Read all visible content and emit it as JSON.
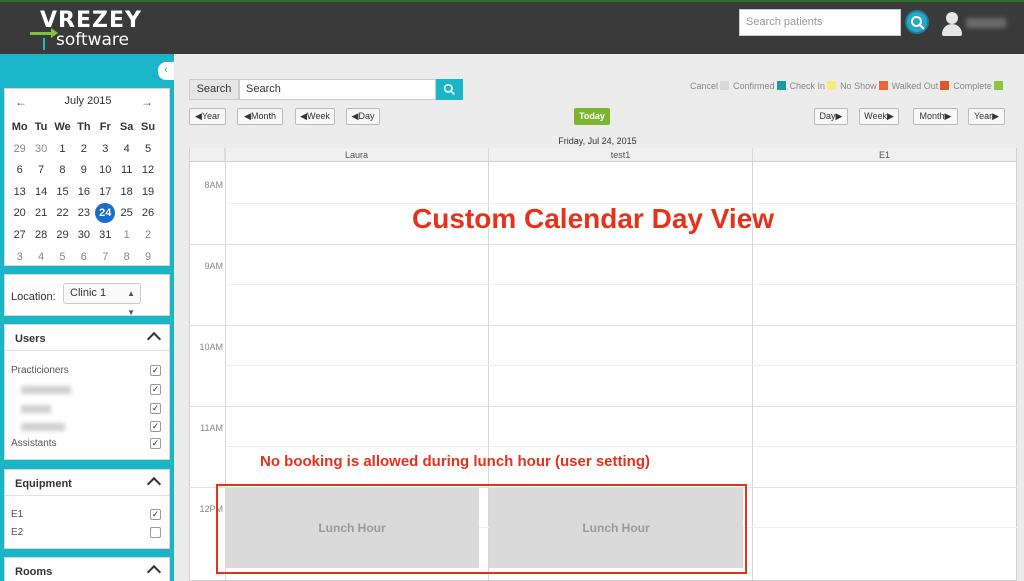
{
  "header": {
    "brand": "VREZEY",
    "brand_sub": "software",
    "search_placeholder": "Search patients"
  },
  "mini_calendar": {
    "month_label": "July 2015",
    "days_of_week": [
      "Mo",
      "Tu",
      "We",
      "Th",
      "Fr",
      "Sa",
      "Su"
    ],
    "weeks": [
      [
        "29",
        "30",
        "1",
        "2",
        "3",
        "4",
        "5"
      ],
      [
        "6",
        "7",
        "8",
        "9",
        "10",
        "11",
        "12"
      ],
      [
        "13",
        "14",
        "15",
        "16",
        "17",
        "18",
        "19"
      ],
      [
        "20",
        "21",
        "22",
        "23",
        "24",
        "25",
        "26"
      ],
      [
        "27",
        "28",
        "29",
        "30",
        "31",
        "1",
        "2"
      ],
      [
        "3",
        "4",
        "5",
        "6",
        "7",
        "8",
        "9"
      ]
    ],
    "selected_day": "24"
  },
  "location": {
    "label": "Location:",
    "value": "Clinic 1"
  },
  "users": {
    "title": "Users",
    "practitioners_label": "Practicioners",
    "assistants_label": "Assistants"
  },
  "equipment": {
    "title": "Equipment",
    "items": [
      {
        "label": "E1",
        "checked": true
      },
      {
        "label": "E2",
        "checked": false
      }
    ]
  },
  "rooms": {
    "title": "Rooms"
  },
  "toolbar": {
    "search_label": "Search",
    "search_value": "Search",
    "back_year": "Year",
    "back_month": "Month",
    "back_week": "Week",
    "back_day": "Day",
    "today": "Today",
    "fwd_day": "Day",
    "fwd_week": "Week",
    "fwd_month": "Month",
    "fwd_year": "Year"
  },
  "legend": [
    {
      "label": "Cancel",
      "color": "#d8d8d8"
    },
    {
      "label": "Confirmed",
      "color": "#1a9aa8"
    },
    {
      "label": "Check In",
      "color": "#f3ee7a"
    },
    {
      "label": "No Show",
      "color": "#e8673a"
    },
    {
      "label": "Walked Out",
      "color": "#e0572f"
    },
    {
      "label": "Complete",
      "color": "#8cc63f"
    }
  ],
  "calendar": {
    "date_title": "Friday, Jul 24, 2015",
    "columns": [
      "Laura",
      "test1",
      "E1"
    ],
    "times": [
      "8AM",
      "9AM",
      "10AM",
      "11AM",
      "12PM"
    ],
    "lunch_label": "Lunch Hour"
  },
  "annotations": {
    "title": "Custom Calendar Day View",
    "lunch_note": "No booking is allowed during lunch hour (user setting)",
    "color": "#e6311b"
  }
}
